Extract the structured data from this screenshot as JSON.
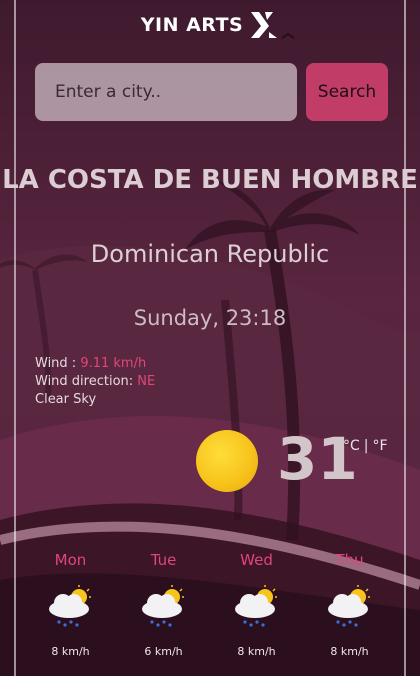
{
  "brand": {
    "name": "YIN ARTS"
  },
  "search": {
    "placeholder": "Enter a city..",
    "value": "",
    "button_label": "Search"
  },
  "location": {
    "city": "LA COSTA DE BUEN HOMBRE",
    "country": "Dominican Republic"
  },
  "datetime": "Sunday, 23:18",
  "details": {
    "wind_label": "Wind : ",
    "wind_value": "9.11 km/h",
    "direction_label": "Wind direction: ",
    "direction_value": "NE",
    "condition": "Clear Sky"
  },
  "current": {
    "temperature": "31",
    "unit_c": "°C",
    "separator": "|",
    "unit_f": "°F",
    "icon": "sun-icon"
  },
  "forecast": [
    {
      "day": "Mon",
      "wind": "8 km/h",
      "icon": "cloud-sun-rain-icon"
    },
    {
      "day": "Tue",
      "wind": "6 km/h",
      "icon": "cloud-sun-rain-icon"
    },
    {
      "day": "Wed",
      "wind": "8 km/h",
      "icon": "cloud-sun-rain-icon"
    },
    {
      "day": "Thu",
      "wind": "8 km/h",
      "icon": "cloud-sun-rain-icon"
    }
  ],
  "colors": {
    "accent": "#e0467a",
    "button": "#c23c68",
    "background": "#4a1e33"
  }
}
